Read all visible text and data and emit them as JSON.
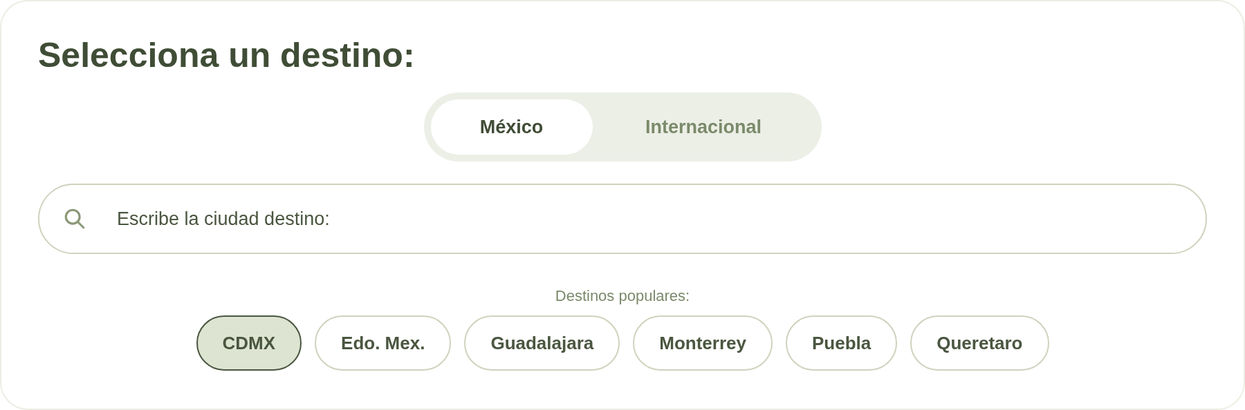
{
  "title": "Selecciona un destino:",
  "tabs": [
    {
      "label": "México",
      "selected": true
    },
    {
      "label": "Internacional",
      "selected": false
    }
  ],
  "search": {
    "placeholder": "Escribe la ciudad destino:"
  },
  "popular": {
    "label": "Destinos populares:",
    "chips": [
      {
        "label": "CDMX",
        "selected": true
      },
      {
        "label": "Edo. Mex.",
        "selected": false
      },
      {
        "label": "Guadalajara",
        "selected": false
      },
      {
        "label": "Monterrey",
        "selected": false
      },
      {
        "label": "Puebla",
        "selected": false
      },
      {
        "label": "Queretaro",
        "selected": false
      }
    ]
  }
}
